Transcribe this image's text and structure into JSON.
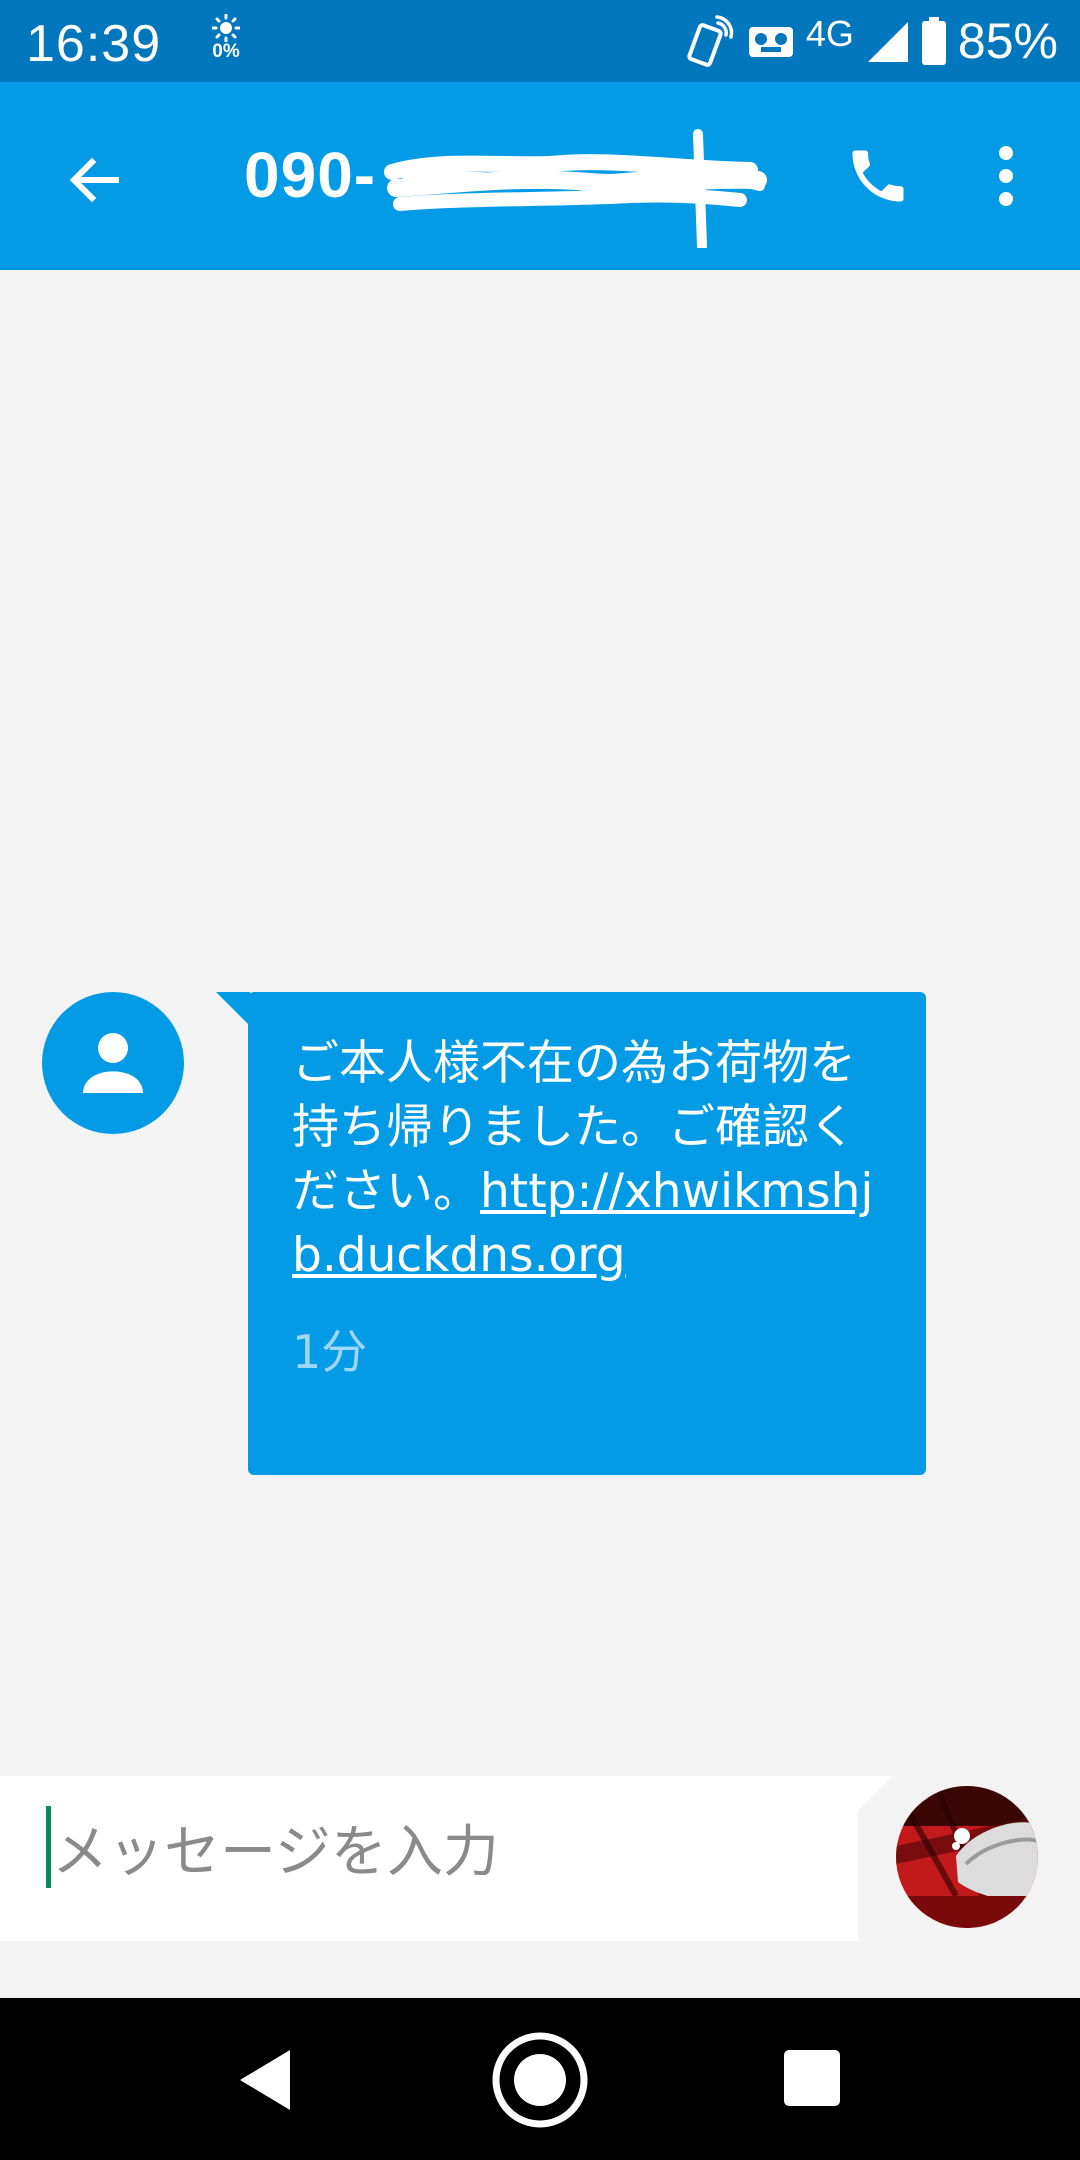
{
  "status_bar": {
    "time": "16:39",
    "brightness_label": "0%",
    "network": "4G",
    "battery": "85%"
  },
  "app_bar": {
    "contact_number": "090-",
    "back_icon": "arrow-back-icon",
    "call_icon": "phone-icon",
    "more_icon": "more-vert-icon"
  },
  "message": {
    "text": "ご本人様不在の為お荷物を持ち帰りました。ご確認ください。",
    "link": "http://xhwikmshjb.duckdns.org",
    "time": "1分",
    "avatar_icon": "person-icon"
  },
  "compose": {
    "placeholder": "メッセージを入力"
  },
  "colors": {
    "status_bar": "#0277bd",
    "app_bar": "#039be5",
    "bubble": "#039be5",
    "background": "#f3f3f3"
  }
}
